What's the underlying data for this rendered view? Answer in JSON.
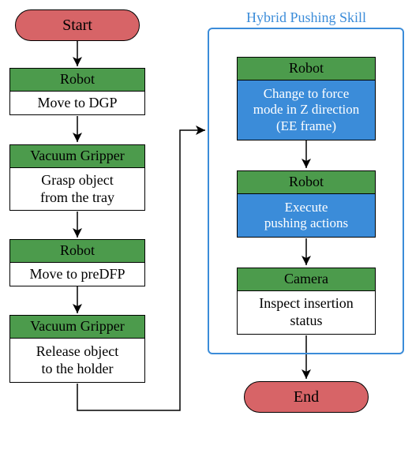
{
  "terminals": {
    "start": "Start",
    "end": "End"
  },
  "left_chain": [
    {
      "header": "Robot",
      "body": "Move to DGP"
    },
    {
      "header": "Vacuum Gripper",
      "body": "Grasp object\nfrom the tray"
    },
    {
      "header": "Robot",
      "body": "Move to preDFP"
    },
    {
      "header": "Vacuum Gripper",
      "body": "Release object\nto the holder"
    }
  ],
  "skill": {
    "title": "Hybrid Pushing Skill",
    "steps": [
      {
        "header": "Robot",
        "body_type": "blue",
        "body": "Change to force\nmode in Z direction\n(EE frame)"
      },
      {
        "header": "Robot",
        "body_type": "blue",
        "body": "Execute\npushing actions"
      },
      {
        "header": "Camera",
        "body_type": "white",
        "body": "Inspect insertion\nstatus"
      }
    ]
  },
  "colors": {
    "terminal": "#d76467",
    "header": "#4c9b4c",
    "blue": "#3b8cd9"
  }
}
